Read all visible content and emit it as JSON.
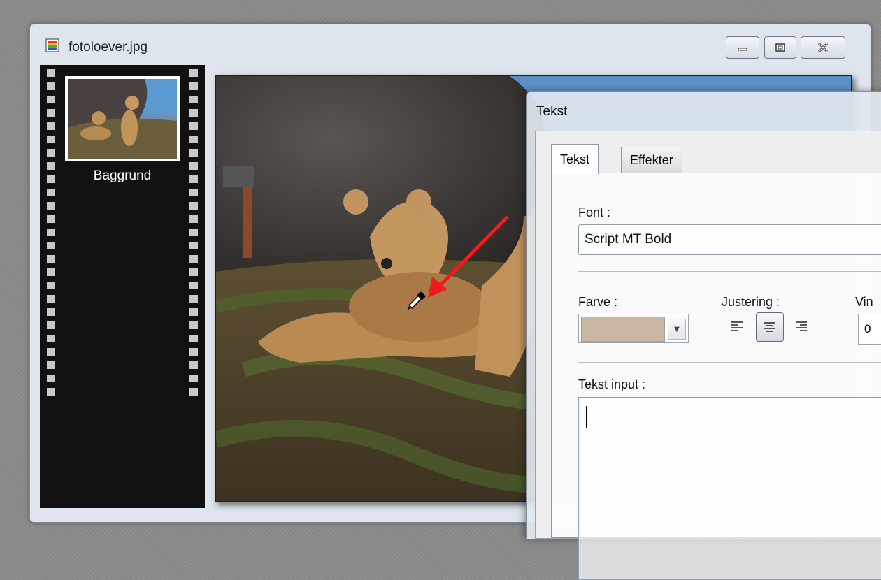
{
  "window": {
    "title": "fotoloever.jpg",
    "icon": "image-file-icon",
    "controls": [
      "minimize-icon",
      "maximize-icon",
      "close-icon"
    ]
  },
  "filmstrip": {
    "thumbnail_label": "Baggrund"
  },
  "dialog": {
    "title": "Tekst",
    "tabs": [
      {
        "label": "Tekst",
        "active": true
      },
      {
        "label": "Effekter",
        "active": false
      }
    ],
    "font": {
      "label": "Font :",
      "value": "Script MT Bold"
    },
    "color": {
      "label": "Farve :",
      "value": "#cbb8a4"
    },
    "alignment": {
      "label": "Justering :",
      "selected": "center",
      "options": [
        "left",
        "center",
        "right"
      ]
    },
    "angle": {
      "label": "Vin",
      "value": "0"
    },
    "text_input": {
      "label": "Tekst input :",
      "value": ""
    }
  },
  "annotation": {
    "color": "#ee1c1c",
    "cursor": "eyedropper-icon"
  }
}
